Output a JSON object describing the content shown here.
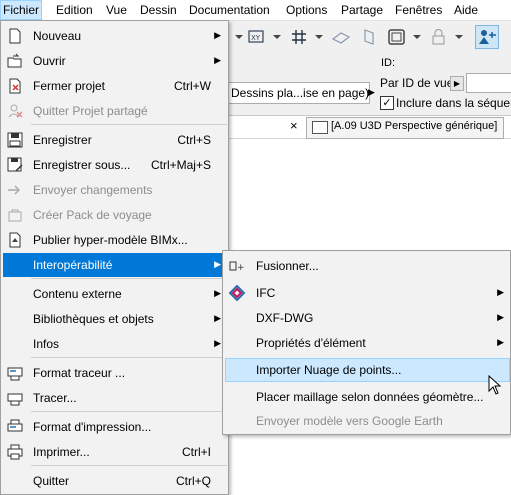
{
  "menubar": {
    "items": [
      "Fichier",
      "Edition",
      "Vue",
      "Dessin",
      "Documentation",
      "Options",
      "Partage",
      "Fenêtres",
      "Aide"
    ]
  },
  "background": {
    "dessins_field": "Dessins pla...ise en page)",
    "id_label": "ID:",
    "par_id_label": "Par ID de vue",
    "include_label": "Inclure dans la séquen",
    "include_checked": "✓",
    "tab_close": "×",
    "tab_label": "[A.09 U3D Perspective générique]"
  },
  "file_menu": {
    "items": [
      {
        "label": "Nouveau",
        "icon": "new-document-icon",
        "submenu": true
      },
      {
        "label": "Ouvrir",
        "icon": "open-folder-icon",
        "submenu": true
      },
      {
        "label": "Fermer projet",
        "shortcut": "Ctrl+W",
        "icon": "close-project-icon"
      },
      {
        "label": "Quitter Projet partagé",
        "icon": "leave-shared-icon",
        "disabled": true
      },
      {
        "label": "Enregistrer",
        "shortcut": "Ctrl+S",
        "icon": "save-icon"
      },
      {
        "label": "Enregistrer sous...",
        "shortcut": "Ctrl+Maj+S",
        "icon": "save-as-icon"
      },
      {
        "label": "Envoyer changements",
        "icon": "send-changes-icon",
        "disabled": true
      },
      {
        "label": "Créer Pack de voyage",
        "icon": "travel-pack-icon",
        "disabled": true
      },
      {
        "label": "Publier hyper-modèle BIMx...",
        "icon": "bimx-icon"
      },
      {
        "label": "Interopérabilité",
        "submenu": true,
        "highlighted": true
      },
      {
        "label": "Contenu externe",
        "submenu": true
      },
      {
        "label": "Bibliothèques et objets",
        "submenu": true
      },
      {
        "label": "Infos",
        "submenu": true
      },
      {
        "label": "Format traceur ...",
        "icon": "plotter-format-icon"
      },
      {
        "label": "Tracer...",
        "icon": "plot-icon"
      },
      {
        "label": "Format d'impression...",
        "icon": "print-format-icon"
      },
      {
        "label": "Imprimer...",
        "shortcut": "Ctrl+I",
        "icon": "printer-icon"
      },
      {
        "label": "Quitter",
        "shortcut": "Ctrl+Q"
      }
    ]
  },
  "interop_submenu": {
    "items": [
      {
        "label": "Fusionner...",
        "icon": "merge-icon"
      },
      {
        "label": "IFC",
        "icon": "ifc-icon",
        "submenu": true
      },
      {
        "label": "DXF-DWG",
        "submenu": true
      },
      {
        "label": "Propriétés d'élément",
        "submenu": true
      },
      {
        "label": "Importer Nuage de points...",
        "highlighted": true
      },
      {
        "label": "Placer maillage selon données géomètre..."
      },
      {
        "label": "Envoyer modèle vers Google Earth",
        "disabled": true
      }
    ]
  },
  "colors": {
    "highlight": "#0078d7",
    "hover": "#cce8ff",
    "disabled_text": "#8d8d8d"
  }
}
